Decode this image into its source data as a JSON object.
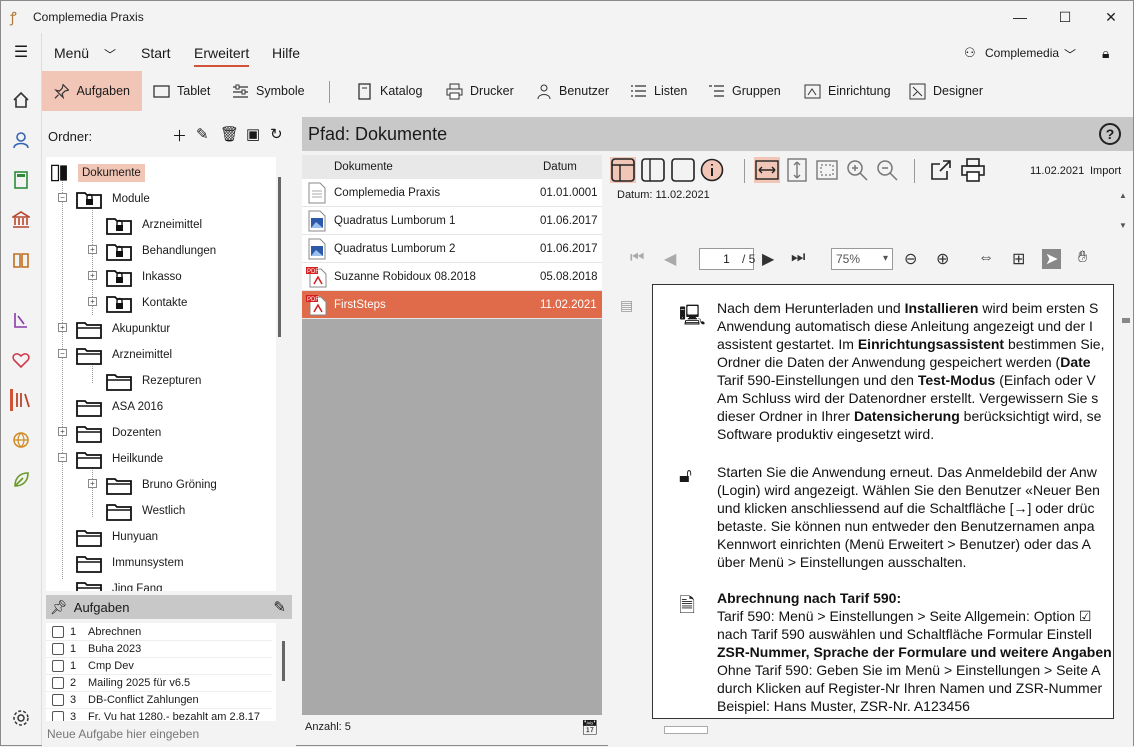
{
  "window": {
    "title": "Complemedia Praxis",
    "minimize": "—",
    "maximize": "☐",
    "close": "✕"
  },
  "menu": {
    "hamburger": "☰",
    "items": [
      "Menü",
      "Start",
      "Erweitert",
      "Hilfe"
    ],
    "active": "Erweitert",
    "user": "Complemedia"
  },
  "toolbar": {
    "left": [
      "Aufgaben",
      "Tablet",
      "Symbole"
    ],
    "right": [
      "Katalog",
      "Drucker",
      "Benutzer",
      "Listen",
      "Gruppen",
      "Einrichtung",
      "Designer"
    ]
  },
  "folders": {
    "header": "Ordner:",
    "tree": [
      {
        "label": "Dokumente",
        "selected": true
      },
      {
        "label": "Module"
      },
      {
        "label": "Arzneimittel"
      },
      {
        "label": "Behandlungen"
      },
      {
        "label": "Inkasso"
      },
      {
        "label": "Kontakte"
      },
      {
        "label": "Akupunktur"
      },
      {
        "label": "Arzneimittel"
      },
      {
        "label": "Rezepturen"
      },
      {
        "label": "ASA 2016"
      },
      {
        "label": "Dozenten"
      },
      {
        "label": "Heilkunde"
      },
      {
        "label": "Bruno Gröning"
      },
      {
        "label": "Westlich"
      },
      {
        "label": "Hunyuan"
      },
      {
        "label": "Immunsystem"
      },
      {
        "label": "Jing Fang"
      }
    ]
  },
  "tasks": {
    "header": "Aufgaben",
    "items": [
      {
        "prio": "1",
        "text": "Abrechnen"
      },
      {
        "prio": "1",
        "text": "Buha 2023"
      },
      {
        "prio": "1",
        "text": "Cmp Dev"
      },
      {
        "prio": "2",
        "text": "Mailing 2025 für v6.5"
      },
      {
        "prio": "3",
        "text": "DB-Conflict Zahlungen"
      },
      {
        "prio": "3",
        "text": "Fr. Vu hat 1280.- bezahlt am 2.8.17"
      }
    ],
    "new_placeholder": "Neue Aufgabe hier eingeben"
  },
  "path": {
    "label": "Pfad: Dokumente",
    "help": "?"
  },
  "documents": {
    "col_name": "Dokumente",
    "col_date": "Datum",
    "rows": [
      {
        "name": "Complemedia Praxis",
        "date": "01.01.0001",
        "icon": "document-icon"
      },
      {
        "name": "Quadratus Lumborum 1",
        "date": "01.06.2017",
        "icon": "image-icon"
      },
      {
        "name": "Quadratus Lumborum 2",
        "date": "01.06.2017",
        "icon": "image-icon"
      },
      {
        "name": "Suzanne Robidoux 08.2018",
        "date": "05.08.2018",
        "icon": "pdf-icon"
      },
      {
        "name": "FirstSteps",
        "date": "11.02.2021",
        "icon": "pdf-icon",
        "selected": true
      }
    ],
    "count": "Anzahl: 5"
  },
  "viewer": {
    "date_right": "11.02.2021",
    "import_label": "Import",
    "datum": "Datum: 11.02.2021",
    "page_current": "1",
    "page_total": "/ 5",
    "zoom": "75%",
    "paragraphs": [
      [
        "Nach dem Herunterladen und ",
        "Installieren",
        " wird beim ersten S"
      ],
      [
        "Anwendung automatisch diese Anleitung angezeigt und der I"
      ],
      [
        "assistent gestartet. Im ",
        "Einrichtungsassistent",
        " bestimmen Sie,"
      ],
      [
        "Ordner die Daten der Anwendung gespeichert werden (",
        "Date"
      ],
      [
        "Tarif 590-Einstellungen und den ",
        "Test-Modus",
        " (Einfach oder V"
      ],
      [
        "Am Schluss wird der Datenordner erstellt. Vergewissern Sie s"
      ],
      [
        "dieser Ordner in Ihrer ",
        "Datensicherung",
        " berücksichtigt wird, se"
      ],
      [
        "Software produktiv eingesetzt wird."
      ]
    ],
    "p2": [
      "Starten Sie die Anwendung erneut. Das Anmeldebild der Anw",
      "(Login) wird angezeigt. Wählen Sie den Benutzer «Neuer Ben",
      "und klicken anschliessend auf die Schaltfläche [→] oder drüc",
      "betaste. Sie können nun entweder den Benutzernamen anpa",
      "Kennwort einrichten (Menü Erweitert > Benutzer) oder das A",
      "über Menü > Einstellungen ausschalten."
    ],
    "p3": [
      "Abrechnung nach Tarif 590:",
      "Tarif 590: Menü > Einstellungen > Seite Allgemein: Option ☑",
      "nach Tarif 590 auswählen und Schaltfläche Formular Einstell",
      "ZSR-Nummer, Sprache der Formulare und weitere Angaben",
      "Ohne Tarif 590: Geben Sie im Menü > Einstellungen > Seite A",
      "durch Klicken auf Register-Nr Ihren Namen und ZSR-Nummer",
      "Beispiel: Hans Muster, ZSR-Nr. A123456"
    ]
  }
}
